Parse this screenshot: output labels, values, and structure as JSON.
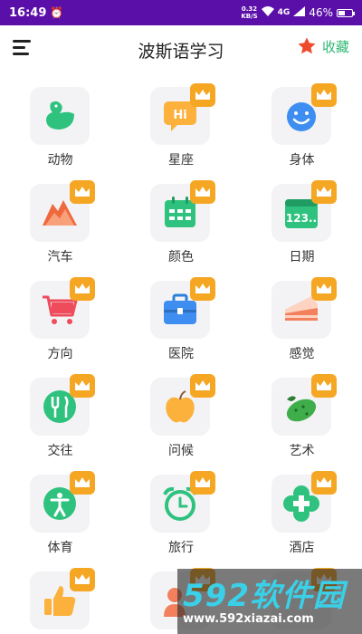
{
  "status": {
    "time": "16:49",
    "speed_top": "0.32",
    "speed_bottom": "KB/S",
    "network": "4G",
    "battery": "46%",
    "battery_level": 0.46
  },
  "header": {
    "title": "波斯语学习",
    "favorites_label": "收藏"
  },
  "colors": {
    "statusbar": "#5a0fa8",
    "accent_green": "#2eb872",
    "star_red": "#ee4b2b",
    "crown_orange": "#f5a623"
  },
  "categories": [
    {
      "label": "动物",
      "icon": "duck-icon",
      "premium": false
    },
    {
      "label": "星座",
      "icon": "hi-bubble-icon",
      "premium": true
    },
    {
      "label": "身体",
      "icon": "smiley-face-icon",
      "premium": true
    },
    {
      "label": "汽车",
      "icon": "mountain-icon",
      "premium": true
    },
    {
      "label": "颜色",
      "icon": "calendar-grid-icon",
      "premium": true
    },
    {
      "label": "日期",
      "icon": "date-123-icon",
      "premium": true
    },
    {
      "label": "方向",
      "icon": "shopping-cart-icon",
      "premium": true
    },
    {
      "label": "医院",
      "icon": "medical-kit-icon",
      "premium": true
    },
    {
      "label": "感觉",
      "icon": "cake-icon",
      "premium": true
    },
    {
      "label": "交往",
      "icon": "utensils-icon",
      "premium": true
    },
    {
      "label": "问候",
      "icon": "apple-icon",
      "premium": true
    },
    {
      "label": "艺术",
      "icon": "vegetable-icon",
      "premium": true
    },
    {
      "label": "体育",
      "icon": "person-icon",
      "premium": true
    },
    {
      "label": "旅行",
      "icon": "alarm-clock-icon",
      "premium": true
    },
    {
      "label": "酒店",
      "icon": "clover-cross-icon",
      "premium": true
    },
    {
      "label": "",
      "icon": "thumbs-up-icon",
      "premium": true
    },
    {
      "label": "",
      "icon": "people-icon",
      "premium": true
    },
    {
      "label": "",
      "icon": "unknown-icon",
      "premium": true
    }
  ],
  "watermark": {
    "logo": "592软件园",
    "url": "www.592xiazai.com"
  }
}
